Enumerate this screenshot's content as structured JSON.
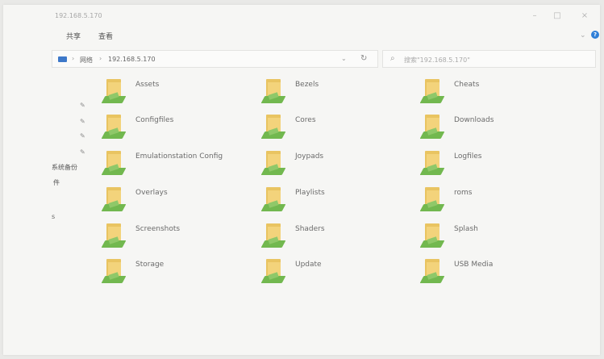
{
  "window": {
    "title": "192.168.5.170",
    "buttons": {
      "minimize": "–",
      "maximize": "□",
      "close": "×"
    }
  },
  "ribbon": {
    "tabs": [
      "共享",
      "查看"
    ],
    "collapse": "⌄",
    "help": "?"
  },
  "address": {
    "separator": "›",
    "crumbs": [
      "网络",
      "192.168.5.170"
    ],
    "dropdown": "⌄",
    "refresh": "↻"
  },
  "search": {
    "icon": "⌕",
    "placeholder": "搜索\"192.168.5.170\""
  },
  "nav": {
    "pin": "✎",
    "label": "系统备份",
    "label2": "件",
    "item": "s"
  },
  "folders": [
    "Assets",
    "Bezels",
    "Cheats",
    "Configfiles",
    "Cores",
    "Downloads",
    "Emulationstation Config",
    "Joypads",
    "Logfiles",
    "Overlays",
    "Playlists",
    "roms",
    "Screenshots",
    "Shaders",
    "Splash",
    "Storage",
    "Update",
    "USB Media"
  ],
  "colors": {
    "folder": "#f3d37b",
    "share_overlay": "#72b84f",
    "accent": "#2f7fd7"
  }
}
